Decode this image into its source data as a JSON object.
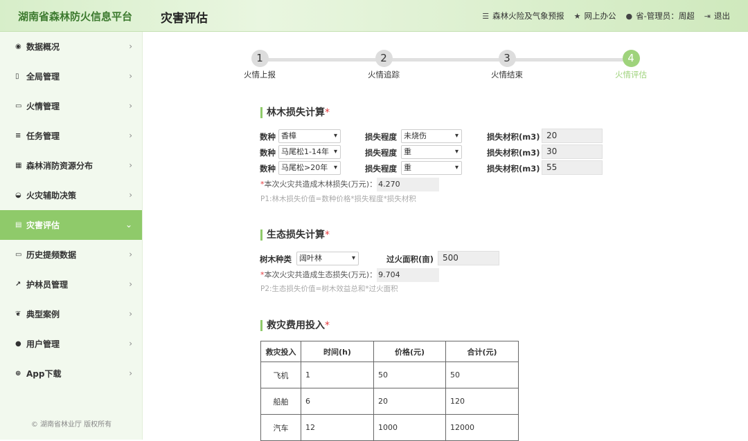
{
  "header": {
    "brand": "湖南省森林防火信息平台",
    "page_title": "灾害评估",
    "nav": [
      {
        "icon": "list-icon",
        "label": "森林火险及气象预报"
      },
      {
        "icon": "star-icon",
        "label": "网上办公"
      },
      {
        "icon": "user-icon",
        "label": "省-管理员：周超"
      },
      {
        "icon": "logout-icon",
        "label": "退出"
      }
    ]
  },
  "sidebar": {
    "items": [
      {
        "icon": "dashboard-icon",
        "label": "数据概况"
      },
      {
        "icon": "book-icon",
        "label": "全局管理"
      },
      {
        "icon": "monitor-icon",
        "label": "火情管理"
      },
      {
        "icon": "tasks-icon",
        "label": "任务管理"
      },
      {
        "icon": "grid-icon",
        "label": "森林消防资源分布"
      },
      {
        "icon": "car-icon",
        "label": "火灾辅助决策"
      },
      {
        "icon": "chart-icon",
        "label": "灾害评估"
      },
      {
        "icon": "laptop-icon",
        "label": "历史提频数据"
      },
      {
        "icon": "external-link-icon",
        "label": "护林员管理"
      },
      {
        "icon": "leaf-icon",
        "label": "典型案例"
      },
      {
        "icon": "user-icon",
        "label": "用户管理"
      },
      {
        "icon": "download-icon",
        "label": "App下载"
      }
    ],
    "active_index": 6,
    "copyright": "© 湖南省林业厅 版权所有"
  },
  "stepper": {
    "steps": [
      {
        "num": "1",
        "label": "火情上报"
      },
      {
        "num": "2",
        "label": "火情追踪"
      },
      {
        "num": "3",
        "label": "火情结束"
      },
      {
        "num": "4",
        "label": "火情评估"
      }
    ],
    "current": 4
  },
  "forest_loss": {
    "title": "林木损失计算",
    "required_mark": "*",
    "species_label": "数种",
    "degree_label": "损失程度",
    "volume_label": "损失材积(m3)",
    "rows": [
      {
        "species": "香樟",
        "degree": "未烧伤",
        "volume": "20"
      },
      {
        "species": "马尾松1-14年",
        "degree": "重",
        "volume": "30"
      },
      {
        "species": "马尾松>20年",
        "degree": "重",
        "volume": "55"
      }
    ],
    "summary_label": "本次火灾共造成木林损失(万元)：",
    "summary_value": "4.270",
    "formula": "P1:林木损失价值=数种价格*损失程度*损失材积"
  },
  "eco_loss": {
    "title": "生态损失计算",
    "required_mark": "*",
    "tree_type_label": "树木种类",
    "tree_type_value": "阔叶林",
    "area_label": "过火面积(亩)",
    "area_value": "500",
    "summary_label": "本次火灾共造成生态损失(万元)：",
    "summary_value": "9.704",
    "formula": "P2:生态损失价值=树木效益总和*过火面积"
  },
  "rescue_cost": {
    "title": "救灾费用投入",
    "required_mark": "*",
    "headers": [
      "救灾投入",
      "时间(h)",
      "价格(元)",
      "合计(元)"
    ],
    "rows": [
      [
        "飞机",
        "1",
        "50",
        "50"
      ],
      [
        "船舶",
        "6",
        "20",
        "120"
      ],
      [
        "汽车",
        "12",
        "1000",
        "12000"
      ]
    ]
  }
}
